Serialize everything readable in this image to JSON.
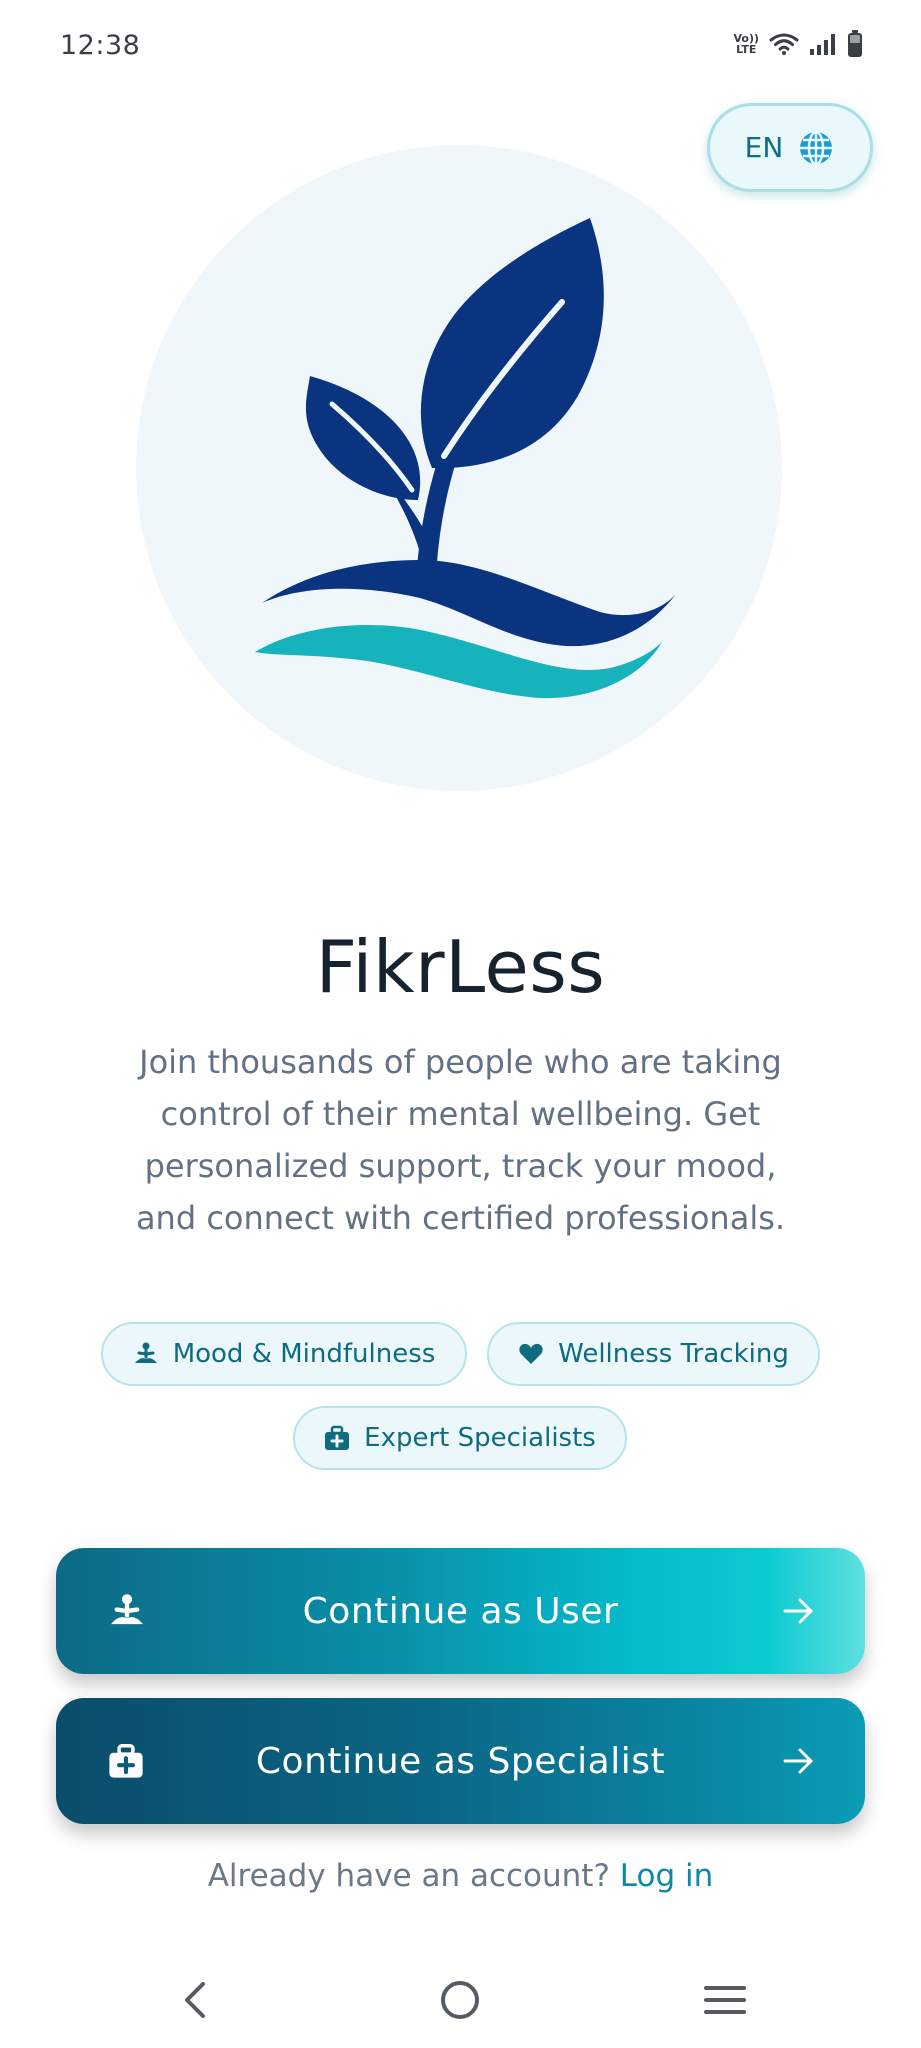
{
  "status_bar": {
    "time": "12:38",
    "volte_top": "Vo))",
    "volte_bottom": "LTE",
    "icons": [
      "volte-icon",
      "wifi-icon",
      "signal-icon",
      "battery-icon"
    ]
  },
  "language": {
    "label": "EN",
    "icon": "globe-icon"
  },
  "app": {
    "title": "FikrLess",
    "tagline": "Join thousands of people who are taking control of their mental wellbeing. Get personalized support, track your mood, and connect with certified professionals."
  },
  "features": [
    {
      "label": "Mood & Mindfulness",
      "icon": "meditation-icon"
    },
    {
      "label": "Wellness Tracking",
      "icon": "heart-icon"
    },
    {
      "label": "Expert Specialists",
      "icon": "medical-bag-icon"
    }
  ],
  "actions": {
    "user": {
      "label": "Continue as User",
      "icon": "meditation-icon",
      "arrow": "arrow-right-icon"
    },
    "specialist": {
      "label": "Continue as Specialist",
      "icon": "medical-bag-icon",
      "arrow": "arrow-right-icon"
    }
  },
  "login": {
    "prompt": "Already have an account?",
    "link": "Log in"
  },
  "colors": {
    "primary": "#0a8aa5",
    "logo_navy": "#0a347f",
    "logo_teal": "#16b3bd",
    "title": "#16232f",
    "muted_text": "#637184"
  }
}
